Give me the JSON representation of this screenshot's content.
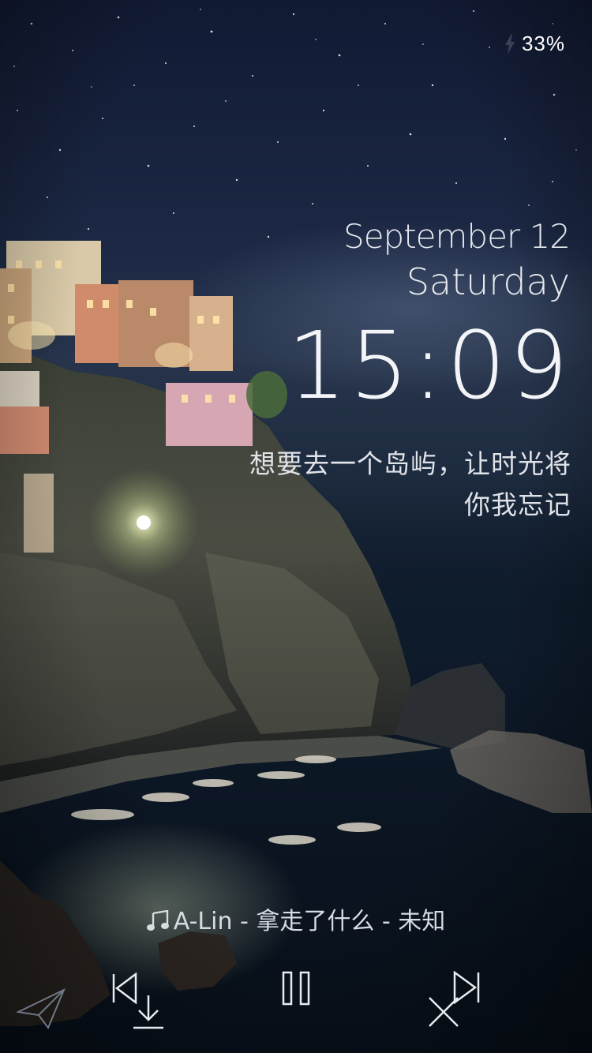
{
  "status_bar": {
    "battery_percent": "33%",
    "charging_icon": "lightning-icon",
    "color": "#ffffff"
  },
  "lockscreen": {
    "date": "September 12",
    "weekday": "Saturday",
    "time": "15:09"
  },
  "lyric": {
    "line1": "想要去一个岛屿，让时光将",
    "line2": "你我忘记"
  },
  "now_playing": {
    "icon": "music-note-icon",
    "text": "A-Lin - 拿走了什么 - 未知"
  },
  "controls": {
    "share_icon": "paper-plane-icon",
    "previous_icon": "previous-track-icon",
    "download_icon": "download-icon",
    "pause_icon": "pause-icon",
    "next_icon": "next-track-icon",
    "dislike_icon": "close-icon"
  },
  "colors": {
    "text_primary": "#f2f4f7",
    "text_secondary": "#e0e3e8",
    "sky_top": "#111a33",
    "sea_bottom": "#070e18"
  }
}
